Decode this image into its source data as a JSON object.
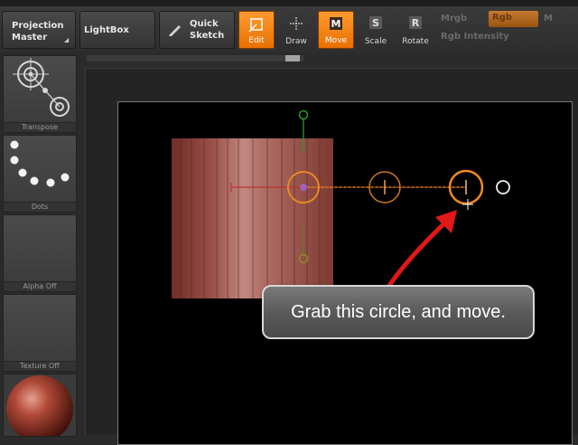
{
  "header": {
    "top_strip_text": "",
    "projection_master_line1": "Projection",
    "projection_master_line2": "Master",
    "lightbox": "LightBox",
    "quick_sketch_line1": "Quick",
    "quick_sketch_line2": "Sketch"
  },
  "tools": {
    "edit": "Edit",
    "draw": "Draw",
    "move": "Move",
    "scale": "Scale",
    "rotate": "Rotate"
  },
  "color_controls": {
    "mrgb": "Mrgb",
    "rgb": "Rgb",
    "m": "M",
    "rgb_intensity": "Rgb Intensity"
  },
  "shelf": {
    "transpose": "Transpose",
    "dots": "Dots",
    "alpha": "Alpha Off",
    "texture": "Texture Off"
  },
  "callout": {
    "text": "Grab this circle, and move."
  },
  "colors": {
    "accent_orange": "#f08a20",
    "transpose_red": "#e03030",
    "arrow_red": "#e01818",
    "mesh_base": "#9a5048",
    "axis_green": "#2a9a2a"
  }
}
